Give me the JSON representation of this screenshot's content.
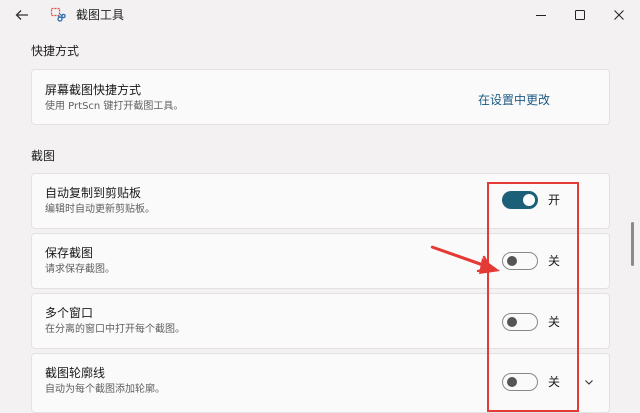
{
  "window": {
    "title": "截图工具",
    "icons": {
      "back": "back-arrow-icon",
      "app": "snipping-tool-icon",
      "minimize": "minimize-icon",
      "maximize": "maximize-icon",
      "close": "close-icon"
    }
  },
  "sections": {
    "shortcuts": "快捷方式",
    "screenshot": "截图"
  },
  "shortcut_card": {
    "title": "屏幕截图快捷方式",
    "subtitle": "使用 PrtScn 键打开截图工具。",
    "link": "在设置中更改"
  },
  "settings": [
    {
      "title": "自动复制到剪贴板",
      "subtitle": "编辑时自动更新剪贴板。",
      "state": "开",
      "on": true
    },
    {
      "title": "保存截图",
      "subtitle": "请求保存截图。",
      "state": "关",
      "on": false
    },
    {
      "title": "多个窗口",
      "subtitle": "在分离的窗口中打开每个截图。",
      "state": "关",
      "on": false
    },
    {
      "title": "截图轮廓线",
      "subtitle": "自动为每个截图添加轮廓。",
      "state": "关",
      "on": false
    }
  ],
  "colors": {
    "accent": "#1b6078",
    "link": "#1d5b87",
    "annotation": "#e53935",
    "background": "#f3f1f1"
  }
}
